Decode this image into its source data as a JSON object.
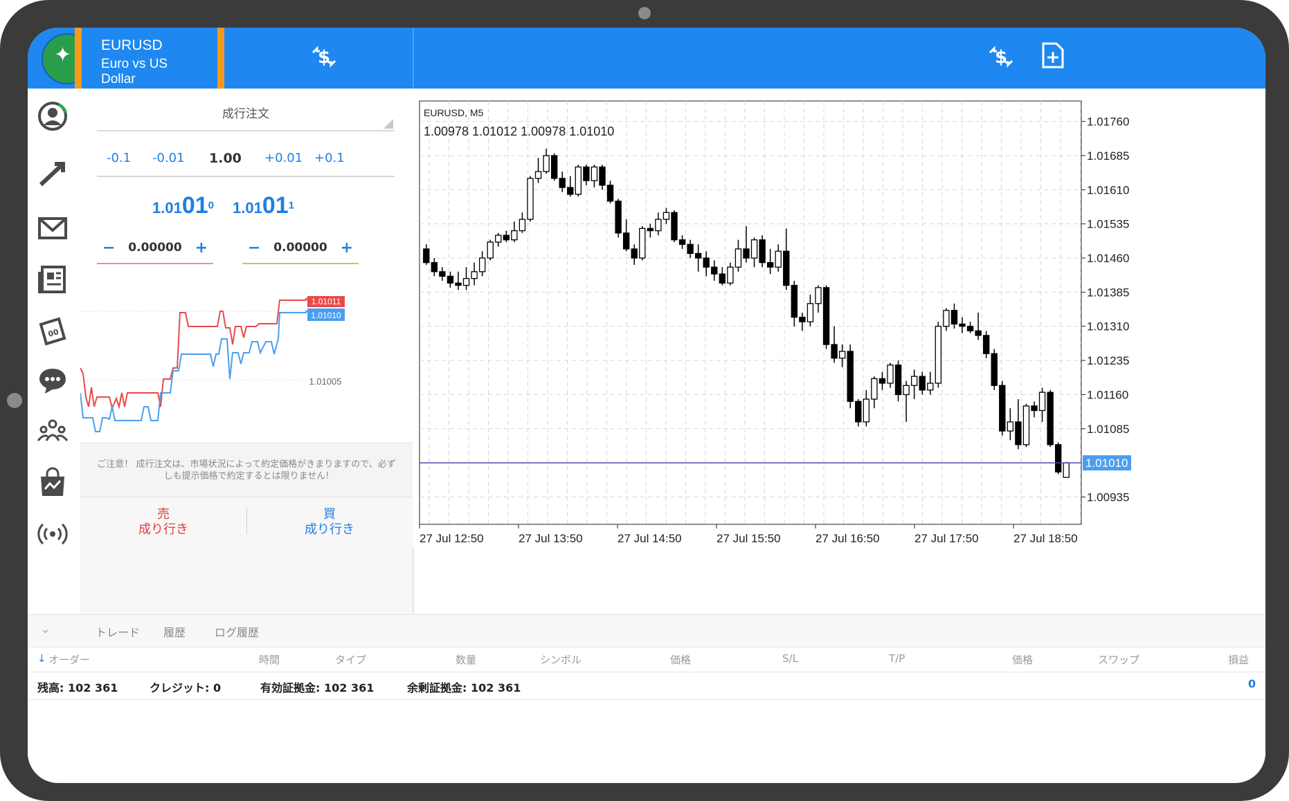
{
  "symbol": {
    "name": "EURUSD",
    "description": "Euro vs US Dollar"
  },
  "order": {
    "type_label": "成行注文",
    "lot_steps": [
      "-0.1",
      "-0.01",
      "1.00",
      "+0.01",
      "+0.1"
    ],
    "bid": {
      "prefix": "1.01",
      "big": "01",
      "sup": "0"
    },
    "ask": {
      "prefix": "1.01",
      "big": "01",
      "sup": "1"
    },
    "sl": {
      "minus": "−",
      "value": "0.00000",
      "plus": "+"
    },
    "tp": {
      "minus": "−",
      "value": "0.00000",
      "plus": "+"
    },
    "tick_labels": {
      "ask": "1.01011",
      "bid": "1.01010",
      "mid": "1.01005"
    },
    "notice": "ご注意！ 成行注文は、市場状況によって約定価格がきまりますので、必ずしも提示価格で約定するとは限りません!",
    "sell": {
      "line1": "売",
      "line2": "成り行き"
    },
    "buy": {
      "line1": "買",
      "line2": "成り行き"
    }
  },
  "colors": {
    "accent": "#1f88f0",
    "highlight": "#f79a1c",
    "ask_line": "#e84a4a",
    "bid_line": "#4a9ef0"
  },
  "chart_data": {
    "type": "candlestick",
    "title": "EURUSD, M5",
    "ohlc_label": "1.00978 1.01012 1.00978 1.01010",
    "current_price": "1.01010",
    "ylim": [
      1.00875,
      1.01805
    ],
    "y_ticks": [
      "1.01760",
      "1.01685",
      "1.01610",
      "1.01535",
      "1.01460",
      "1.01385",
      "1.01310",
      "1.01235",
      "1.01160",
      "1.01085",
      "1.00935"
    ],
    "x_ticks": [
      "27 Jul 12:50",
      "27 Jul 13:50",
      "27 Jul 14:50",
      "27 Jul 15:50",
      "27 Jul 16:50",
      "27 Jul 17:50",
      "27 Jul 18:50"
    ],
    "candles": [
      [
        1.0148,
        1.0149,
        1.01445,
        1.0145
      ],
      [
        1.0145,
        1.0146,
        1.0142,
        1.0143
      ],
      [
        1.0143,
        1.0144,
        1.0141,
        1.0142
      ],
      [
        1.0142,
        1.0143,
        1.01395,
        1.01405
      ],
      [
        1.01405,
        1.0143,
        1.0139,
        1.014
      ],
      [
        1.014,
        1.0144,
        1.0139,
        1.01415
      ],
      [
        1.01415,
        1.0145,
        1.014,
        1.0143
      ],
      [
        1.0143,
        1.01475,
        1.0142,
        1.0146
      ],
      [
        1.0146,
        1.015,
        1.01455,
        1.01495
      ],
      [
        1.01495,
        1.01515,
        1.01485,
        1.0151
      ],
      [
        1.0151,
        1.0152,
        1.01495,
        1.015
      ],
      [
        1.015,
        1.0154,
        1.01495,
        1.0152
      ],
      [
        1.0152,
        1.0156,
        1.01515,
        1.01545
      ],
      [
        1.01545,
        1.0164,
        1.0154,
        1.01635
      ],
      [
        1.01635,
        1.0168,
        1.01625,
        1.0165
      ],
      [
        1.0165,
        1.017,
        1.01645,
        1.01685
      ],
      [
        1.01685,
        1.0169,
        1.0163,
        1.01635
      ],
      [
        1.01635,
        1.0165,
        1.01605,
        1.01615
      ],
      [
        1.01615,
        1.0164,
        1.01595,
        1.016
      ],
      [
        1.016,
        1.01665,
        1.01595,
        1.0166
      ],
      [
        1.0166,
        1.01665,
        1.0162,
        1.0163
      ],
      [
        1.0163,
        1.01665,
        1.01615,
        1.0166
      ],
      [
        1.0166,
        1.01665,
        1.0161,
        1.0162
      ],
      [
        1.0162,
        1.0163,
        1.0158,
        1.01585
      ],
      [
        1.01585,
        1.0159,
        1.01505,
        1.01515
      ],
      [
        1.01515,
        1.01545,
        1.01475,
        1.0148
      ],
      [
        1.0148,
        1.0149,
        1.01445,
        1.0146
      ],
      [
        1.0146,
        1.0153,
        1.01455,
        1.01525
      ],
      [
        1.01525,
        1.01535,
        1.01505,
        1.0152
      ],
      [
        1.0152,
        1.0156,
        1.0151,
        1.01545
      ],
      [
        1.01545,
        1.0157,
        1.01535,
        1.0156
      ],
      [
        1.0156,
        1.01565,
        1.01495,
        1.015
      ],
      [
        1.015,
        1.0151,
        1.0148,
        1.0149
      ],
      [
        1.0149,
        1.015,
        1.0146,
        1.0147
      ],
      [
        1.0147,
        1.0149,
        1.0143,
        1.0146
      ],
      [
        1.0146,
        1.01475,
        1.0142,
        1.0144
      ],
      [
        1.0144,
        1.01455,
        1.0141,
        1.01425
      ],
      [
        1.01425,
        1.0144,
        1.014,
        1.01405
      ],
      [
        1.01405,
        1.0145,
        1.014,
        1.0144
      ],
      [
        1.0144,
        1.015,
        1.0143,
        1.0148
      ],
      [
        1.0148,
        1.0153,
        1.0145,
        1.0146
      ],
      [
        1.0146,
        1.01505,
        1.0144,
        1.015
      ],
      [
        1.015,
        1.0151,
        1.0144,
        1.0145
      ],
      [
        1.0145,
        1.0148,
        1.01425,
        1.0144
      ],
      [
        1.0144,
        1.0149,
        1.0143,
        1.01475
      ],
      [
        1.01475,
        1.01525,
        1.0139,
        1.014
      ],
      [
        1.014,
        1.0141,
        1.0131,
        1.0133
      ],
      [
        1.0133,
        1.0134,
        1.013,
        1.0132
      ],
      [
        1.0132,
        1.0138,
        1.0131,
        1.0136
      ],
      [
        1.0136,
        1.014,
        1.0134,
        1.01395
      ],
      [
        1.01395,
        1.014,
        1.0126,
        1.0127
      ],
      [
        1.0127,
        1.0131,
        1.0123,
        1.0124
      ],
      [
        1.0124,
        1.0127,
        1.0122,
        1.01255
      ],
      [
        1.01255,
        1.0127,
        1.0113,
        1.01145
      ],
      [
        1.01145,
        1.0115,
        1.0109,
        1.011
      ],
      [
        1.011,
        1.0117,
        1.0109,
        1.0115
      ],
      [
        1.0115,
        1.012,
        1.0113,
        1.01195
      ],
      [
        1.01195,
        1.0121,
        1.0117,
        1.01185
      ],
      [
        1.01185,
        1.0123,
        1.01175,
        1.01225
      ],
      [
        1.01225,
        1.01235,
        1.01145,
        1.0116
      ],
      [
        1.0116,
        1.0119,
        1.011,
        1.0118
      ],
      [
        1.0118,
        1.01215,
        1.0115,
        1.012
      ],
      [
        1.012,
        1.0121,
        1.0116,
        1.0117
      ],
      [
        1.0117,
        1.0121,
        1.0116,
        1.01185
      ],
      [
        1.01185,
        1.0132,
        1.01175,
        1.0131
      ],
      [
        1.0131,
        1.0135,
        1.013,
        1.01345
      ],
      [
        1.01345,
        1.0136,
        1.01305,
        1.01315
      ],
      [
        1.01315,
        1.0133,
        1.01295,
        1.0131
      ],
      [
        1.0131,
        1.0132,
        1.01295,
        1.013
      ],
      [
        1.013,
        1.0134,
        1.0128,
        1.0129
      ],
      [
        1.0129,
        1.013,
        1.0124,
        1.0125
      ],
      [
        1.0125,
        1.0126,
        1.0117,
        1.0118
      ],
      [
        1.0118,
        1.0119,
        1.0107,
        1.0108
      ],
      [
        1.0108,
        1.0113,
        1.0106,
        1.011
      ],
      [
        1.011,
        1.0115,
        1.0104,
        1.0105
      ],
      [
        1.0105,
        1.0114,
        1.01045,
        1.01135
      ],
      [
        1.01135,
        1.01145,
        1.0111,
        1.01125
      ],
      [
        1.01125,
        1.01175,
        1.011,
        1.01165
      ],
      [
        1.01165,
        1.0117,
        1.01045,
        1.0105
      ],
      [
        1.0105,
        1.01055,
        1.00985,
        1.0099
      ],
      [
        1.00978,
        1.01012,
        1.00978,
        1.0101
      ]
    ]
  },
  "bottom": {
    "tabs": [
      "トレード",
      "履歴",
      "ログ履歴"
    ],
    "columns": [
      "オーダー",
      "時間",
      "タイプ",
      "数量",
      "シンボル",
      "価格",
      "S/L",
      "T/P",
      "価格",
      "スワップ",
      "損益"
    ],
    "summary": [
      {
        "label": "残高:",
        "value": "102 361"
      },
      {
        "label": "クレジット:",
        "value": "0"
      },
      {
        "label": "有効証拠金:",
        "value": "102 361"
      },
      {
        "label": "余剰証拠金:",
        "value": "102 361"
      }
    ],
    "profit": "0"
  }
}
